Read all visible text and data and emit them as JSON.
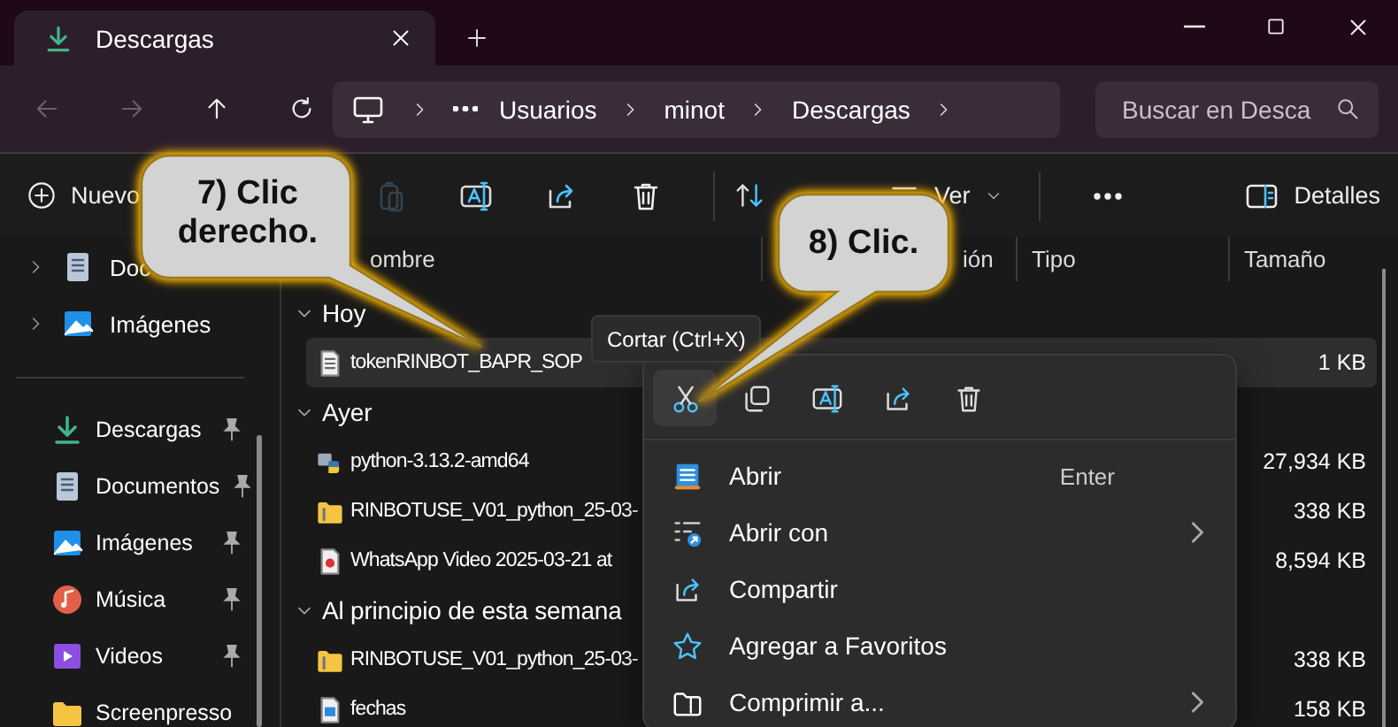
{
  "tab": {
    "title": "Descargas",
    "selected": true
  },
  "nav_buttons": [
    {
      "kind": "back",
      "disabled": true
    },
    {
      "kind": "forward",
      "disabled": true
    },
    {
      "kind": "up",
      "disabled": false
    },
    {
      "kind": "refresh",
      "disabled": false
    }
  ],
  "breadcrumb": [
    "Usuarios",
    "minot",
    "Descargas"
  ],
  "search": {
    "placeholder": "Buscar en Desca"
  },
  "toolbar": {
    "new": "Nuevo",
    "actions": [
      {
        "kind": "paste",
        "disabled": true
      },
      {
        "kind": "rename",
        "disabled": false
      },
      {
        "kind": "share",
        "disabled": false
      },
      {
        "kind": "delete",
        "disabled": false
      }
    ],
    "view": "Ver",
    "details": "Detalles"
  },
  "sidebar": {
    "top_items": [
      {
        "label": "Doc",
        "kind": "documents"
      },
      {
        "label": "Imágenes",
        "kind": "pictures"
      }
    ],
    "quick_access": [
      {
        "label": "Descargas",
        "kind": "downloads",
        "pinned": true
      },
      {
        "label": "Documentos",
        "kind": "documents",
        "pinned": true
      },
      {
        "label": "Imágenes",
        "kind": "pictures",
        "pinned": true
      },
      {
        "label": "Música",
        "kind": "music",
        "pinned": true
      },
      {
        "label": "Videos",
        "kind": "videos",
        "pinned": true
      },
      {
        "label": "Screenpresso",
        "kind": "folder",
        "pinned": false
      }
    ]
  },
  "table": {
    "columns": [
      "ombre",
      "ión",
      "Tipo",
      "Tamaño"
    ],
    "groups": [
      {
        "label": "Hoy",
        "expanded": true,
        "rows": [
          {
            "name": "tokenRINBOT_BAPR_SOP",
            "kind": "text",
            "size": "1 KB",
            "selected": true
          }
        ]
      },
      {
        "label": "Ayer",
        "expanded": true,
        "rows": [
          {
            "name": "python-3.13.2-amd64",
            "kind": "installer",
            "size": "27,934 KB",
            "selected": false
          },
          {
            "name": "RINBOTUSE_V01_python_25-03-",
            "kind": "zip",
            "size": "338 KB",
            "selected": false
          },
          {
            "name": "WhatsApp Video 2025-03-21 at",
            "kind": "video",
            "size": "8,594 KB",
            "selected": false
          }
        ]
      },
      {
        "label": "Al principio de esta semana",
        "expanded": true,
        "rows": [
          {
            "name": "RINBOTUSE_V01_python_25-03-",
            "kind": "zip",
            "size": "338 KB",
            "selected": false
          },
          {
            "name": "fechas",
            "kind": "image",
            "size": "158 KB",
            "selected": false
          }
        ]
      }
    ]
  },
  "tooltip": "Cortar (Ctrl+X)",
  "context_menu": {
    "actions": [
      {
        "kind": "cut",
        "selected": true
      },
      {
        "kind": "copy",
        "selected": false
      },
      {
        "kind": "rename",
        "selected": false
      },
      {
        "kind": "share",
        "selected": false
      },
      {
        "kind": "delete",
        "selected": false
      }
    ],
    "items": [
      {
        "label": "Abrir",
        "kind": "notepad",
        "shortcut": "Enter",
        "submenu": false
      },
      {
        "label": "Abrir con",
        "kind": "open-with",
        "submenu": true
      },
      {
        "label": "Compartir",
        "kind": "share",
        "submenu": false
      },
      {
        "label": "Agregar a Favoritos",
        "kind": "star",
        "submenu": false
      },
      {
        "label": "Comprimir a...",
        "kind": "zip-folder",
        "submenu": true
      }
    ]
  },
  "callouts": [
    {
      "text": "7) Clic derecho."
    },
    {
      "text": "8) Clic."
    }
  ]
}
